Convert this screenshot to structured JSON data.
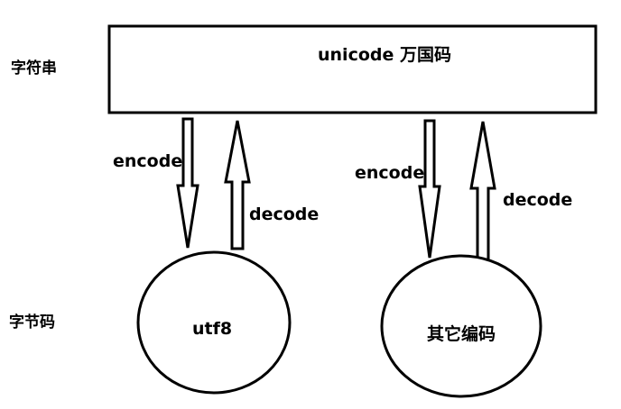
{
  "labels": {
    "string_layer": "字符串",
    "bytes_layer": "字节码"
  },
  "unicode_box": {
    "label": "unicode 万国码"
  },
  "nodes": {
    "utf8": "utf8",
    "other": "其它编码"
  },
  "arrows": {
    "left_encode": "encode",
    "left_decode": "decode",
    "right_encode": "encode",
    "right_decode": "decode"
  },
  "colors": {
    "stroke": "#000000",
    "background": "#ffffff"
  }
}
